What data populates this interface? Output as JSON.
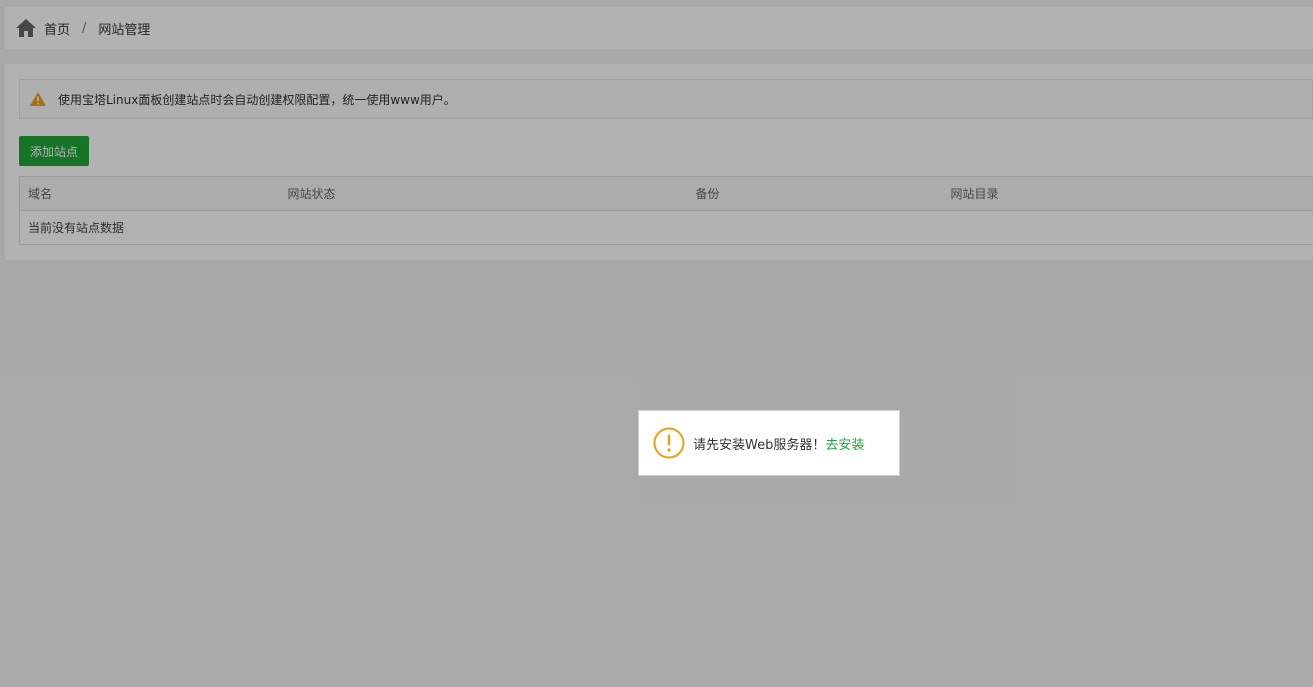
{
  "breadcrumb": {
    "home_icon": "home-icon",
    "home_label": "首页",
    "separator": "/",
    "current": "网站管理"
  },
  "alert": {
    "icon": "warning-icon",
    "text": "使用宝塔Linux面板创建站点时会自动创建权限配置，统一使用www用户。"
  },
  "toolbar": {
    "add_site_label": "添加站点"
  },
  "table": {
    "columns": [
      "域名",
      "网站状态",
      "备份",
      "网站目录"
    ],
    "empty_text": "当前没有站点数据"
  },
  "dialog": {
    "icon": "exclamation-circle-icon",
    "message": "请先安装Web服务器！",
    "link_label": "去安装"
  },
  "colors": {
    "accent": "#20a53a",
    "warning": "#e8a01e"
  }
}
